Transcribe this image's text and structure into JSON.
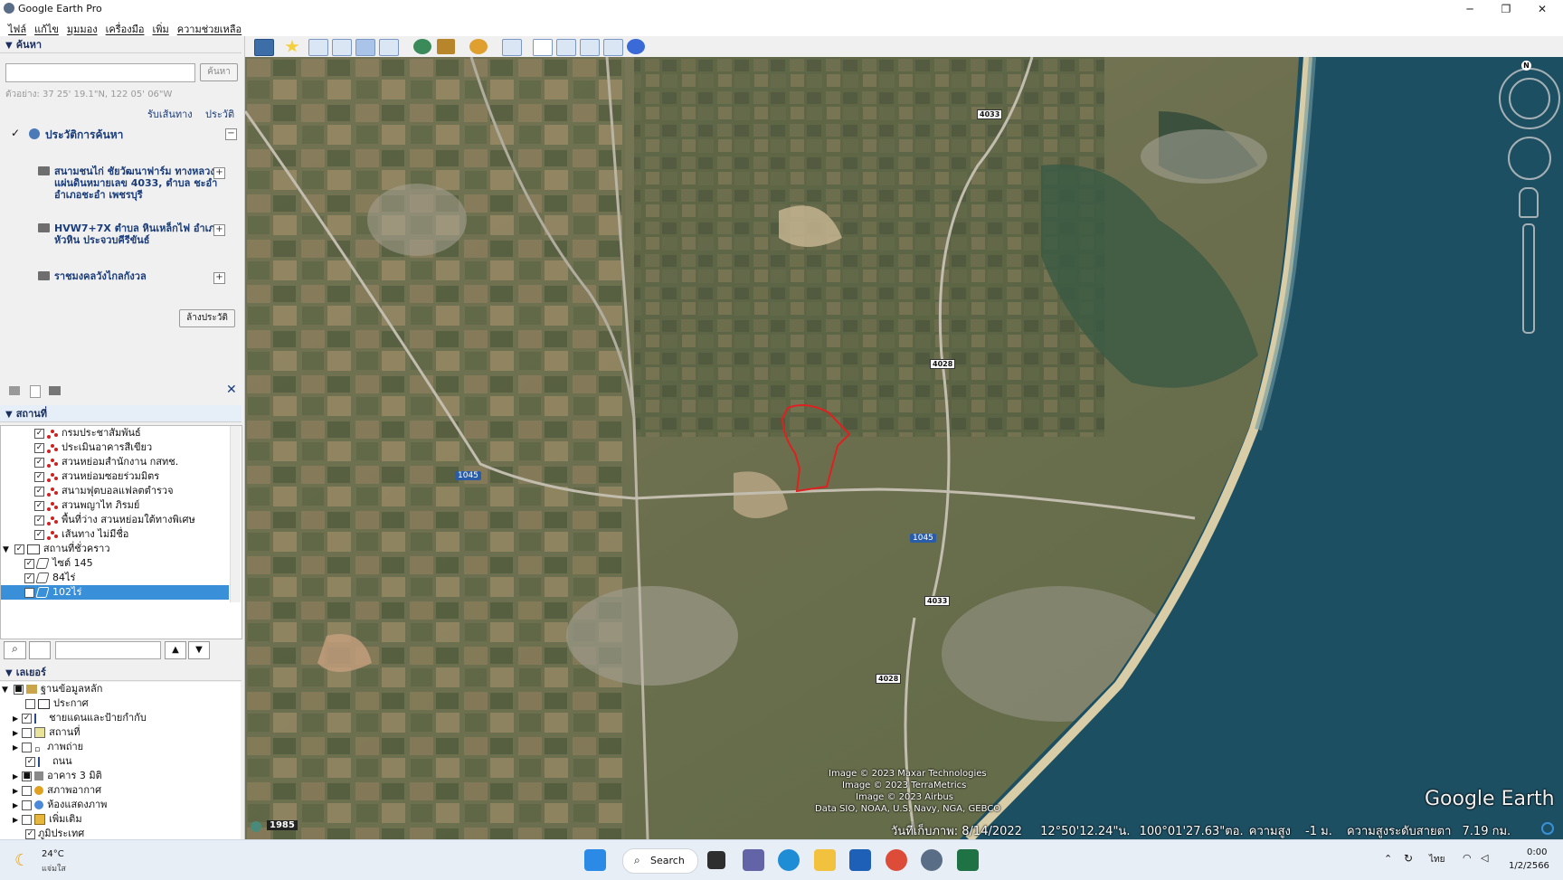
{
  "window": {
    "title": "Google Earth Pro",
    "minimize": "─",
    "maximize": "❐",
    "close": "✕"
  },
  "menu": [
    "ไฟล์",
    "แก้ไข",
    "มุมมอง",
    "เครื่องมือ",
    "เพิ่ม",
    "ความช่วยเหลือ"
  ],
  "search": {
    "header": "ค้นหา",
    "input_value": "",
    "search_button": "ค้นหา",
    "example": "ตัวอย่าง: 37 25' 19.1\"N, 122 05' 06\"W",
    "directions_link": "รับเส้นทาง",
    "history_link": "ประวัติ",
    "history_title": "ประวัติการค้นหา",
    "history_items": [
      "สนามชนไก่ ชัยวัฒนาฟาร์ม ทางหลวงแผ่นดินหมายเลข 4033, ตำบล ชะอำ อำเภอชะอำ เพชรบุรี",
      "HVW7+7X ตำบล หินเหล็กไฟ อำเภอหัวหิน ประจวบคีรีขันธ์",
      "ราชมงคลวังไกลกังวล"
    ],
    "clear_history": "ล้างประวัติ"
  },
  "places": {
    "header": "สถานที่",
    "items": [
      {
        "label": "กรมประชาสัมพันธ์",
        "checked": true
      },
      {
        "label": "ประเมินอาคารสีเขียว",
        "checked": true
      },
      {
        "label": "สวนหย่อมสำนักงาน กสทช.",
        "checked": true
      },
      {
        "label": "สวนหย่อมซอยร่วมมิตร",
        "checked": true
      },
      {
        "label": "สนามฟุตบอลแฟลตตำรวจ",
        "checked": true
      },
      {
        "label": "สวนพญาไท ภิรมย์",
        "checked": true
      },
      {
        "label": "พื้นที่ว่าง สวนหย่อมใต้ทางพิเศษ",
        "checked": true
      },
      {
        "label": "เส้นทาง ไม่มีชื่อ",
        "checked": true
      }
    ],
    "temp_folder": "สถานที่ชั่วคราว",
    "temp_items": [
      {
        "label": "ไซต์ 145",
        "checked": true
      },
      {
        "label": "84ไร่",
        "checked": true
      },
      {
        "label": "102ไร่",
        "checked": true,
        "selected": true
      }
    ]
  },
  "layers": {
    "header": "เลเยอร์",
    "root": "ฐานข้อมูลหลัก",
    "items": [
      {
        "label": "ประกาศ",
        "checked": false
      },
      {
        "label": "ชายแดนและป้ายกำกับ",
        "checked": true
      },
      {
        "label": "สถานที่",
        "checked": false
      },
      {
        "label": "ภาพถ่าย",
        "checked": false
      },
      {
        "label": "ถนน",
        "checked": true
      },
      {
        "label": "อาคาร 3 มิติ",
        "checked": false
      },
      {
        "label": "สภาพอากาศ",
        "checked": false
      },
      {
        "label": "ห้องแสดงภาพ",
        "checked": false
      },
      {
        "label": "เพิ่มเติม",
        "checked": false
      }
    ],
    "terrain": "ภูมิประเทศ"
  },
  "map": {
    "road_labels": [
      "4033",
      "4028",
      "1045",
      "1045",
      "4033",
      "4028"
    ],
    "credits": [
      "Image © 2023 Maxar Technologies",
      "Image © 2023 TerraMetrics",
      "Image © 2023 Airbus",
      "Data SIO, NOAA, U.S. Navy, NGA, GEBCO"
    ],
    "watermark": "Google Earth",
    "year_badge": "1985",
    "status_date": "วันที่เก็บภาพ: 8/14/2022",
    "status_lat": "12°50'12.24\"น.",
    "status_lon": "100°01'27.63\"ตอ.",
    "status_elev_label": "ความสูง",
    "status_elev": "-1 ม.",
    "status_alt_label": "ความสูงระดับสายตา",
    "status_alt": "7.19 กม.",
    "compass_north": "N"
  },
  "taskbar": {
    "weather_temp": "24°C",
    "weather_desc": "แจ่มใส",
    "search_label": "Search",
    "lang": "ไทย",
    "time": "0:00",
    "date": "1/2/2566"
  },
  "colors": {
    "selection": "#3a8fd9",
    "polygon": "#e02020",
    "sea": "#1d4f63"
  }
}
